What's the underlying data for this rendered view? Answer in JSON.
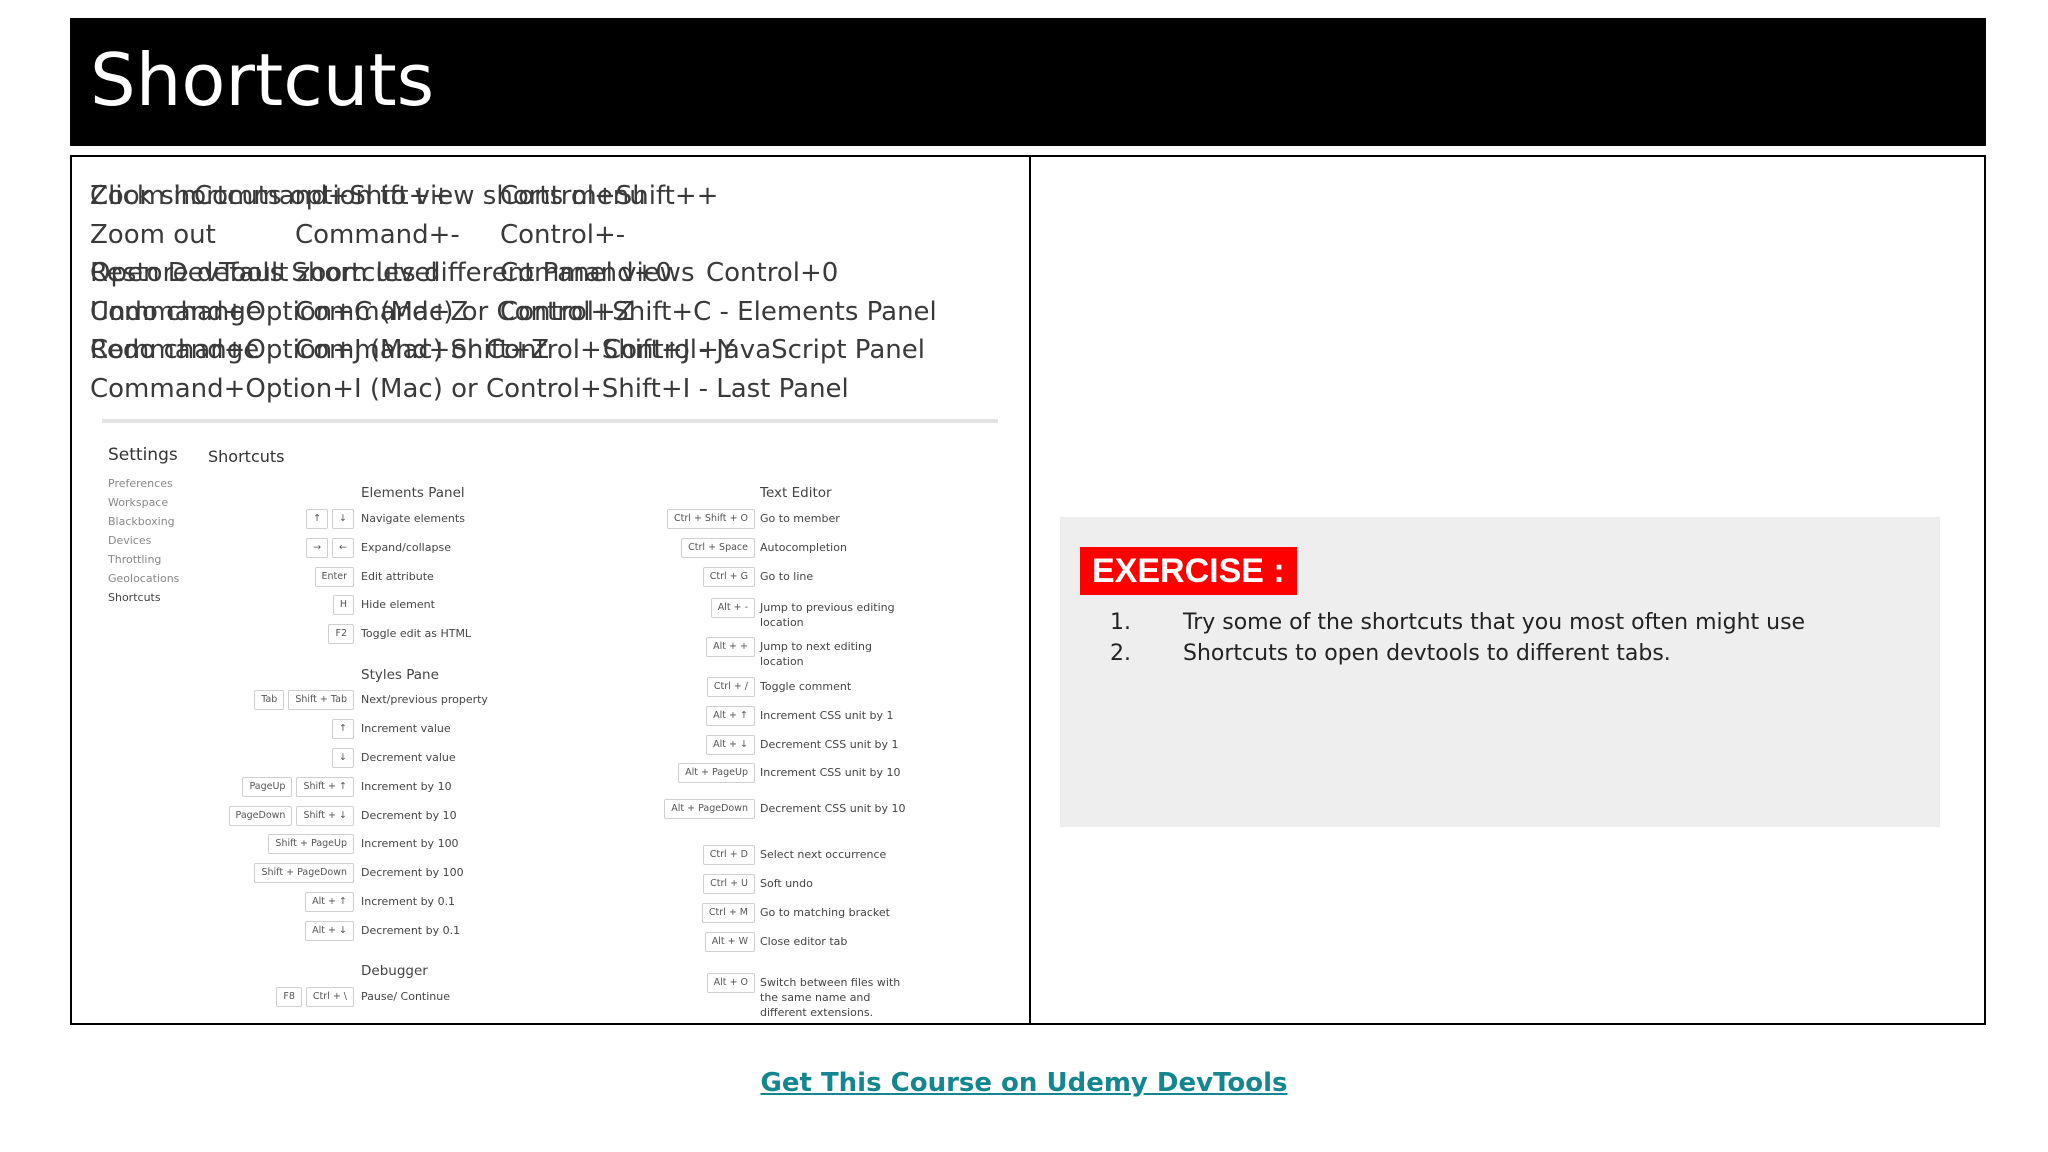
{
  "title": "Shortcuts",
  "left_lines": [
    "Click shortcuts option to view shorts menu",
    "",
    "Open DevTools Shortcuts different Panel views",
    "Command+Option+C (Mac) or Control+Shift+C  - Elements Panel",
    "Command+Option+J (Mac) or Control+Shift+J - JavaScript Panel",
    "Command+Option+I (Mac) or Control+Shift+I - Last Panel"
  ],
  "settings_panel": {
    "settings_label": "Settings",
    "heading": "Shortcuts",
    "nav": [
      "Preferences",
      "Workspace",
      "Blackboxing",
      "Devices",
      "Throttling",
      "Geolocations",
      "Shortcuts"
    ],
    "elements_panel": {
      "title": "Elements Panel",
      "rows": [
        {
          "keys": [
            "↑",
            "↓"
          ],
          "desc": "Navigate elements"
        },
        {
          "keys": [
            "→",
            "←"
          ],
          "desc": "Expand/collapse"
        },
        {
          "keys": [
            "Enter"
          ],
          "desc": "Edit attribute"
        },
        {
          "keys": [
            "H"
          ],
          "desc": "Hide element"
        },
        {
          "keys": [
            "F2"
          ],
          "desc": "Toggle edit as HTML"
        }
      ]
    },
    "styles_pane": {
      "title": "Styles Pane",
      "rows": [
        {
          "keys": [
            "Tab",
            "Shift + Tab"
          ],
          "desc": "Next/previous property"
        },
        {
          "keys": [
            "↑"
          ],
          "desc": "Increment value"
        },
        {
          "keys": [
            "↓"
          ],
          "desc": "Decrement value"
        },
        {
          "keys": [
            "PageUp",
            "Shift + ↑"
          ],
          "desc": "Increment by 10"
        },
        {
          "keys": [
            "PageDown",
            "Shift + ↓"
          ],
          "desc": "Decrement by 10"
        },
        {
          "keys": [
            "Shift + PageUp"
          ],
          "desc": "Increment by 100"
        },
        {
          "keys": [
            "Shift + PageDown"
          ],
          "desc": "Decrement by 100"
        },
        {
          "keys": [
            "Alt + ↑"
          ],
          "desc": "Increment by 0.1"
        },
        {
          "keys": [
            "Alt + ↓"
          ],
          "desc": "Decrement by 0.1"
        }
      ]
    },
    "debugger": {
      "title": "Debugger",
      "rows": [
        {
          "keys": [
            "F8",
            "Ctrl + \\"
          ],
          "desc": "Pause/ Continue"
        }
      ]
    },
    "text_editor": {
      "title": "Text Editor",
      "rows": [
        {
          "keys": [
            "Ctrl + Shift + O"
          ],
          "desc": "Go to member"
        },
        {
          "keys": [
            "Ctrl + Space"
          ],
          "desc": "Autocompletion"
        },
        {
          "keys": [
            "Ctrl + G"
          ],
          "desc": "Go to line"
        },
        {
          "keys": [
            "Alt + -"
          ],
          "desc": "Jump to previous editing location"
        },
        {
          "keys": [
            "Alt + +"
          ],
          "desc": "Jump to next editing location"
        },
        {
          "keys": [
            "Ctrl + /"
          ],
          "desc": "Toggle comment"
        },
        {
          "keys": [
            "Alt + ↑"
          ],
          "desc": "Increment CSS unit by 1"
        },
        {
          "keys": [
            "Alt + ↓"
          ],
          "desc": "Decrement CSS unit by 1"
        },
        {
          "keys": [
            "Alt + PageUp"
          ],
          "desc": "Increment CSS unit by 10"
        },
        {
          "keys": [
            "Alt + PageDown"
          ],
          "desc": "Decrement CSS unit by 10"
        },
        {
          "keys": [
            "Ctrl + D"
          ],
          "desc": "Select next occurrence"
        },
        {
          "keys": [
            "Ctrl + U"
          ],
          "desc": "Soft undo"
        },
        {
          "keys": [
            "Ctrl + M"
          ],
          "desc": "Go to matching bracket"
        },
        {
          "keys": [
            "Alt + W"
          ],
          "desc": "Close editor tab"
        },
        {
          "keys": [
            "Alt + O"
          ],
          "desc": "Switch between files with the same name and different extensions."
        }
      ]
    }
  },
  "zoom_rows": [
    {
      "label": "Zoom in",
      "mac": "Command+Shift++",
      "win": "Control+Shift++"
    },
    {
      "label": "Zoom out",
      "mac": "Command+-",
      "win": "Control+-"
    },
    {
      "label": "Restore default zoom level",
      "mac": "Command+0",
      "win": "Control+0"
    },
    {
      "label": "Undo change",
      "mac": "Command+Z",
      "win": "Control+Z"
    },
    {
      "label": "Redo change",
      "mac": "Command+Shift+Z",
      "win": "Control+Y"
    }
  ],
  "exercise": {
    "label": "EXERCISE :",
    "items": [
      {
        "num": "1.",
        "text": "Try some of the shortcuts that you most often might use"
      },
      {
        "num": "2.",
        "text": "Shortcuts to open devtools to different tabs."
      }
    ]
  },
  "footer_link": "Get This Course on Udemy DevTools",
  "colors": {
    "title_bar": "#000000",
    "exercise_label": "#ff0000",
    "exercise_box": "#efeeef",
    "link": "#138690"
  }
}
